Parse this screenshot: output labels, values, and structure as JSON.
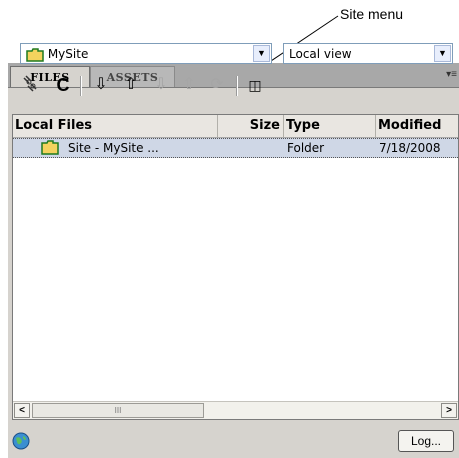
{
  "callout": {
    "label": "Site menu"
  },
  "tabs": [
    {
      "label": "FILES",
      "active": true
    },
    {
      "label": "ASSETS",
      "active": false
    }
  ],
  "panel_menu_icon": "panel-options-icon",
  "site_select": {
    "value": "MySite",
    "icon": "folder-icon"
  },
  "view_select": {
    "value": "Local view"
  },
  "toolbar": [
    {
      "name": "connect-icon",
      "enabled": true
    },
    {
      "name": "refresh-icon",
      "enabled": true
    },
    {
      "name": "get-files-icon",
      "enabled": true
    },
    {
      "name": "put-files-icon",
      "enabled": true
    },
    {
      "name": "check-out-icon",
      "enabled": false
    },
    {
      "name": "check-in-icon",
      "enabled": false
    },
    {
      "name": "synchronize-icon",
      "enabled": false
    },
    {
      "name": "expand-icon",
      "enabled": true
    }
  ],
  "filelist": {
    "columns": [
      "Local Files",
      "Size",
      "Type",
      "Modified"
    ],
    "rows": [
      {
        "name": "Site - MySite ...",
        "size": "",
        "type": "Folder",
        "modified": "7/18/2008"
      }
    ],
    "scroll_thumb": "III"
  },
  "status": {
    "log_button": "Log...",
    "icon": "globe-icon"
  },
  "colors": {
    "panel_bg": "#d6d3ce",
    "selected_row": "#cfd7e6",
    "tab_bar": "#a8a8a8"
  }
}
